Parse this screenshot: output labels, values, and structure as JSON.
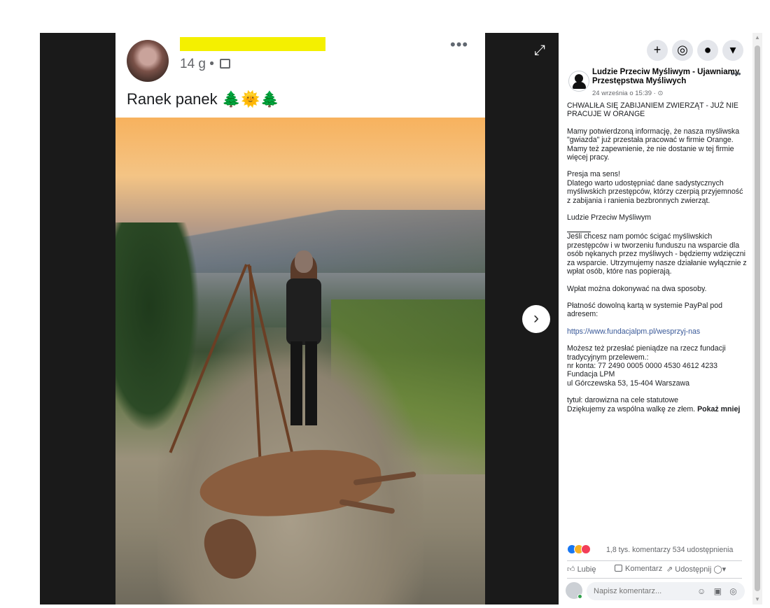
{
  "screenshot": {
    "meta": "14 g •",
    "caption": "Ranek panek",
    "caption_emoji": [
      "🌲",
      "🌞",
      "🌲"
    ]
  },
  "topbar": {
    "add": "+",
    "messenger": "◎",
    "notifications": "●",
    "menu": "▾"
  },
  "post": {
    "page_name": "Ludzie Przeciw Myśliwym - Ujawniamy Przestępstwa Myśliwych",
    "date": "24 września o 15:39 ·",
    "dots": "•••",
    "paragraphs": [
      "CHWALIŁA SIĘ ZABIJANIEM ZWIERZĄT - JUŻ NIE PRACUJE W ORANGE",
      "Mamy potwierdzoną informację, że nasza myśliwska \"gwiazda\" już przestała pracować w firmie Orange.\nMamy też zapewnienie, że nie dostanie w tej firmie więcej pracy.",
      "Presja ma sens!\nDlatego warto udostępniać dane sadystycznych myśliwskich przestępców, którzy czerpią przyjemność z zabijania i ranienia bezbronnych zwierząt.",
      "Ludzie Przeciw Myśliwym"
    ],
    "paragraphs2": [
      "Jeśli chcesz nam pomóc ścigać myśliwskich przestępców i w tworzeniu funduszu na wsparcie dla osób nękanych przez myśliwych - będziemy wdzięczni za wsparcie. Utrzymujemy nasze działanie wyłącznie z wpłat osób, które nas popierają.",
      "Wpłat można dokonywać na dwa sposoby.",
      "Płatność dowolną kartą w systemie PayPal pod adresem:"
    ],
    "link": "https://www.fundacjalpm.pl/wesprzyj-nas",
    "paragraphs3": [
      "Możesz też przesłać pieniądze na rzecz fundacji tradycyjnym przelewem.:\nnr konta: 77 2490 0005 0000 4530 4612 4233\nFundacja LPM\nul Górczewska 53, 15-404 Warszawa"
    ],
    "last_line": "tytuł: darowizna na cele statutowe\nDziękujemy za wspólna walkę ze złem.",
    "show_less": "Pokaż mniej"
  },
  "reactions": {
    "stats": "1,8 tys. komentarzy 534 udostępnienia"
  },
  "actions": {
    "like": "Lubię",
    "comment": "Komentarz",
    "share": "Udostępnij"
  },
  "comment": {
    "placeholder": "Napisz komentarz...",
    "icons": "☺ ▣ ◎"
  },
  "viewer": {
    "next": "›",
    "expand": "⤢"
  }
}
